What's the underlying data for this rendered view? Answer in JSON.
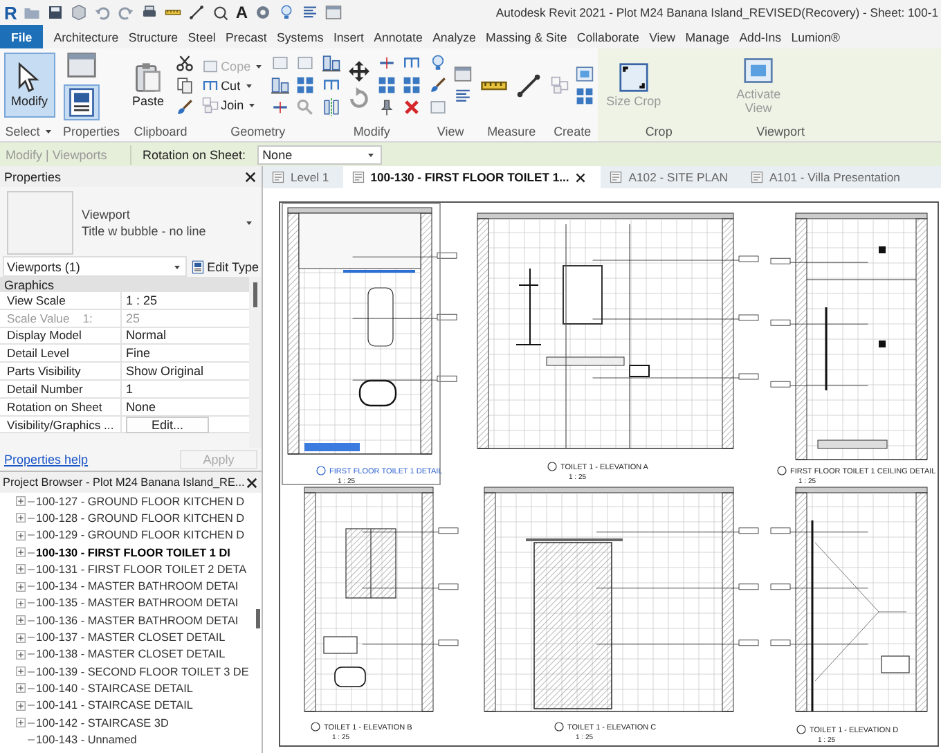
{
  "window": {
    "logo": "R",
    "text_tool": "A",
    "title": "Autodesk Revit 2021 - Plot M24 Banana Island_REVISED(Recovery) - Sheet: 100-1"
  },
  "ribbon_tabs": [
    {
      "label": "File",
      "kind": "file"
    },
    {
      "label": "Architecture",
      "kind": "tab"
    },
    {
      "label": "Structure",
      "kind": "tab"
    },
    {
      "label": "Steel",
      "kind": "tab"
    },
    {
      "label": "Precast",
      "kind": "tab"
    },
    {
      "label": "Systems",
      "kind": "tab"
    },
    {
      "label": "Insert",
      "kind": "tab"
    },
    {
      "label": "Annotate",
      "kind": "tab"
    },
    {
      "label": "Analyze",
      "kind": "tab"
    },
    {
      "label": "Massing & Site",
      "kind": "tab"
    },
    {
      "label": "Collaborate",
      "kind": "tab"
    },
    {
      "label": "View",
      "kind": "tab"
    },
    {
      "label": "Manage",
      "kind": "tab"
    },
    {
      "label": "Add-Ins",
      "kind": "tab"
    },
    {
      "label": "Lumion®",
      "kind": "tab"
    }
  ],
  "ribbon_panels": [
    {
      "label": "Select",
      "menu": true,
      "buttons": [
        {
          "label": "Modify",
          "selected": true
        }
      ]
    },
    {
      "label": "Properties"
    },
    {
      "label": "Clipboard",
      "buttons": [
        {
          "label": "Paste"
        }
      ]
    },
    {
      "label": "Geometry",
      "buttons": [
        {
          "label": "Cope",
          "disabled": true
        },
        {
          "label": "Cut",
          "disabled": false
        },
        {
          "label": "Join",
          "disabled": false
        }
      ]
    },
    {
      "label": "Modify"
    },
    {
      "label": "View"
    },
    {
      "label": "Measure"
    },
    {
      "label": "Create"
    },
    {
      "label": "Crop",
      "contextual": true,
      "buttons": [
        {
          "label": "Size Crop"
        }
      ]
    },
    {
      "label": "Viewport",
      "contextual": true,
      "buttons": [
        {
          "label": "Activate View"
        }
      ]
    }
  ],
  "options_bar": {
    "context": "Modify | Viewports",
    "field_label": "Rotation on Sheet:",
    "field_value": "None"
  },
  "properties": {
    "title": "Properties",
    "type_family": "Viewport",
    "type_name": "Title w bubble - no line",
    "selector": "Viewports (1)",
    "edit_type": "Edit Type",
    "group": "Graphics",
    "rows": [
      {
        "name": "View Scale",
        "value": "1 : 25",
        "kind": "value",
        "disabled": false
      },
      {
        "name": "Scale Value    1:",
        "value": "25",
        "kind": "value",
        "disabled": true
      },
      {
        "name": "Display Model",
        "value": "Normal",
        "kind": "value",
        "disabled": false
      },
      {
        "name": "Detail Level",
        "value": "Fine",
        "kind": "value",
        "disabled": false
      },
      {
        "name": "Parts Visibility",
        "value": "Show Original",
        "kind": "value",
        "disabled": false
      },
      {
        "name": "Detail Number",
        "value": "1",
        "kind": "value",
        "disabled": false
      },
      {
        "name": "Rotation on Sheet",
        "value": "None",
        "kind": "value",
        "disabled": false
      },
      {
        "name": "Visibility/Graphics ...",
        "value": "Edit...",
        "kind": "button",
        "disabled": false
      }
    ],
    "help_link": "Properties help",
    "apply": {
      "label": "Apply",
      "disabled": true
    }
  },
  "project_browser": {
    "title": "Project Browser - Plot M24 Banana Island_RE...",
    "items": [
      {
        "label": "100-127 - GROUND FLOOR KITCHEN D",
        "expandable": true,
        "current": false
      },
      {
        "label": "100-128 - GROUND FLOOR KITCHEN D",
        "expandable": true,
        "current": false
      },
      {
        "label": "100-129 - GROUND FLOOR KITCHEN D",
        "expandable": true,
        "current": false
      },
      {
        "label": "100-130 - FIRST FLOOR TOILET 1  DI",
        "expandable": true,
        "current": true
      },
      {
        "label": "100-131 - FIRST FLOOR TOILET 2  DETA",
        "expandable": true,
        "current": false
      },
      {
        "label": "100-134 - MASTER BATHROOM DETAI",
        "expandable": true,
        "current": false
      },
      {
        "label": "100-135 - MASTER BATHROOM DETAI",
        "expandable": true,
        "current": false
      },
      {
        "label": "100-136 - MASTER BATHROOM DETAI",
        "expandable": true,
        "current": false
      },
      {
        "label": "100-137 - MASTER CLOSET DETAIL",
        "expandable": true,
        "current": false
      },
      {
        "label": "100-138 - MASTER CLOSET DETAIL",
        "expandable": true,
        "current": false
      },
      {
        "label": "100-139 - SECOND FLOOR TOILET 3 DE",
        "expandable": true,
        "current": false
      },
      {
        "label": "100-140 - STAIRCASE DETAIL",
        "expandable": true,
        "current": false
      },
      {
        "label": "100-141 - STAIRCASE DETAIL",
        "expandable": true,
        "current": false
      },
      {
        "label": "100-142 - STAIRCASE 3D",
        "expandable": true,
        "current": false
      },
      {
        "label": "100-143 - Unnamed",
        "expandable": false,
        "current": false
      }
    ]
  },
  "document_tabs": [
    {
      "label": "Level 1",
      "selected": false
    },
    {
      "label": "100-130 - FIRST FLOOR TOILET 1...",
      "selected": true
    },
    {
      "label": "A102 - SITE PLAN",
      "selected": false
    },
    {
      "label": "A101 - Villa Presentation",
      "selected": false
    }
  ],
  "sheet": {
    "viewports": [
      {
        "title": "FIRST FLOOR TOILET 1 DETAIL",
        "scale": "1 : 25",
        "selected": true
      },
      {
        "title": "TOILET 1 - ELEVATION A",
        "scale": "1 : 25",
        "selected": false
      },
      {
        "title": "FIRST FLOOR TOILET 1 CEILING DETAIL",
        "scale": "1 : 25",
        "selected": false
      },
      {
        "title": "TOILET 1 - ELEVATION B",
        "scale": "1 : 25",
        "selected": false
      },
      {
        "title": "TOILET 1 - ELEVATION C",
        "scale": "1 : 25",
        "selected": false
      },
      {
        "title": "TOILET 1 - ELEVATION D",
        "scale": "1 : 25",
        "selected": false
      }
    ]
  }
}
